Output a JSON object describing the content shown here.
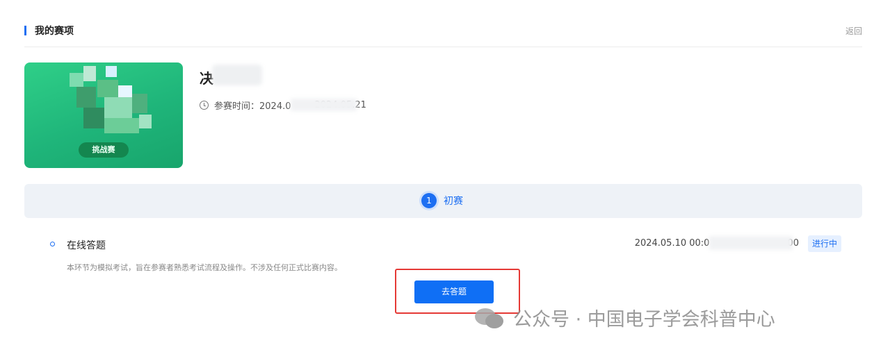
{
  "header": {
    "title": "我的赛项",
    "back_label": "返回"
  },
  "event": {
    "name": "决 ",
    "cover_tag": "挑战赛",
    "time_label": "参赛时间：2024.0",
    "time_end": "2024.05.21"
  },
  "stages": [
    {
      "number": "1",
      "label": "初赛"
    }
  ],
  "task": {
    "name": "在线答题",
    "time_range": "2024.05.10 00:0",
    "time_range_end": "00",
    "status": "进行中",
    "description": "本环节为模拟考试，旨在参赛者熟悉考试流程及操作。不涉及任何正式比赛内容。",
    "button_label": "去答题"
  },
  "watermark": {
    "text": "公众号 · 中国电子学会科普中心"
  },
  "colors": {
    "accent": "#1d6ff2",
    "highlight": "#e53935",
    "stage_bg": "#eef2f7"
  }
}
